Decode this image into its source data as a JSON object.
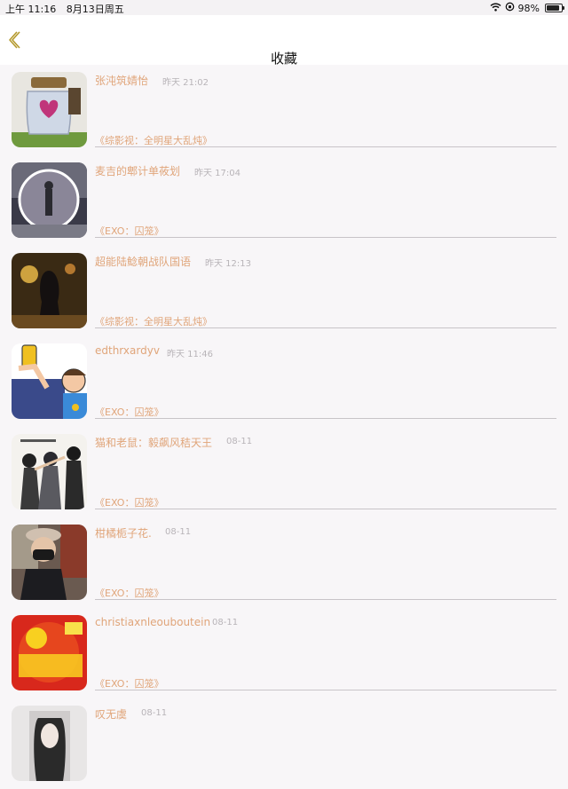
{
  "status_bar": {
    "time": "上午 11:16",
    "date": "8月13日周五",
    "battery": "98%"
  },
  "nav": {
    "title": "收藏"
  },
  "items": [
    {
      "author": "张沌筑婧怡",
      "time": "昨天 21:02",
      "book": "《综影视：全明星大乱炖》"
    },
    {
      "author": "麦吉的郫计单莜划",
      "time": "昨天 17:04",
      "book": "《EXO：囚笼》"
    },
    {
      "author": "超能陆鲶朝战队国语",
      "time": "昨天 12:13",
      "book": "《综影视：全明星大乱炖》"
    },
    {
      "author": "edthrxardyv",
      "time": "昨天 11:46",
      "book": "《EXO：囚笼》"
    },
    {
      "author": "猫和老鼠：毅飙风秸天王",
      "time": "08-11",
      "book": "《EXO：囚笼》"
    },
    {
      "author": "柑橘栀子花.",
      "time": "08-11",
      "book": "《EXO：囚笼》"
    },
    {
      "author": "christiaxnleouboutein",
      "time": "08-11",
      "book": "《EXO：囚笼》"
    },
    {
      "author": "叹无虞",
      "time": "08-11",
      "book": ""
    }
  ],
  "icons": {
    "back": "chevron-left-icon",
    "wifi": "wifi-icon",
    "orientation_lock": "orientation-lock-icon",
    "battery": "battery-icon"
  },
  "colors": {
    "accent": "#e0a57a",
    "back_arrow": "#b59a2e",
    "time_text": "#b8b4b8"
  }
}
